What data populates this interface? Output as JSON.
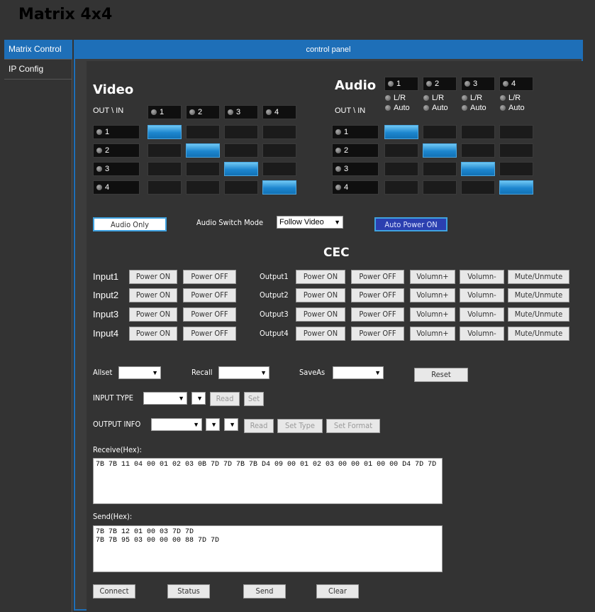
{
  "app": {
    "title": "Matrix 4x4"
  },
  "sidebar": {
    "items": [
      {
        "label": "Matrix Control"
      },
      {
        "label": "IP Config"
      }
    ]
  },
  "main": {
    "header": "control panel"
  },
  "video": {
    "title": "Video",
    "corner_label": "OUT \\ IN",
    "inputs": [
      "1",
      "2",
      "3",
      "4"
    ],
    "outputs": [
      "1",
      "2",
      "3",
      "4"
    ],
    "routing": [
      1,
      2,
      3,
      4
    ]
  },
  "audio": {
    "title": "Audio",
    "corner_label": "OUT \\ IN",
    "inputs": [
      "1",
      "2",
      "3",
      "4"
    ],
    "outputs": [
      "1",
      "2",
      "3",
      "4"
    ],
    "lr_label": "L/R",
    "auto_label": "Auto",
    "routing": [
      1,
      2,
      3,
      4
    ]
  },
  "controls": {
    "audio_only": "Audio Only",
    "audio_switch_mode_label": "Audio Switch Mode",
    "audio_switch_mode_value": "Follow Video",
    "auto_power_on": "Auto Power ON"
  },
  "cec": {
    "title": "CEC",
    "inputs": [
      {
        "label": "Input1",
        "power_on": "Power ON",
        "power_off": "Power OFF"
      },
      {
        "label": "Input2",
        "power_on": "Power ON",
        "power_off": "Power OFF"
      },
      {
        "label": "Input3",
        "power_on": "Power ON",
        "power_off": "Power OFF"
      },
      {
        "label": "Input4",
        "power_on": "Power ON",
        "power_off": "Power OFF"
      }
    ],
    "outputs": [
      {
        "label": "Output1",
        "power_on": "Power ON",
        "power_off": "Power OFF",
        "vol_up": "Volumn+",
        "vol_down": "Volumn-",
        "mute": "Mute/Unmute"
      },
      {
        "label": "Output2",
        "power_on": "Power ON",
        "power_off": "Power OFF",
        "vol_up": "Volumn+",
        "vol_down": "Volumn-",
        "mute": "Mute/Unmute"
      },
      {
        "label": "Output3",
        "power_on": "Power ON",
        "power_off": "Power OFF",
        "vol_up": "Volumn+",
        "vol_down": "Volumn-",
        "mute": "Mute/Unmute"
      },
      {
        "label": "Output4",
        "power_on": "Power ON",
        "power_off": "Power OFF",
        "vol_up": "Volumn+",
        "vol_down": "Volumn-",
        "mute": "Mute/Unmute"
      }
    ]
  },
  "presets": {
    "allset": "Allset",
    "recall": "Recall",
    "saveas": "SaveAs",
    "reset": "Reset"
  },
  "input_type": {
    "label": "INPUT TYPE",
    "read": "Read",
    "set": "Set"
  },
  "output_info": {
    "label": "OUTPUT INFO",
    "read": "Read",
    "set_type": "Set Type",
    "set_format": "Set Format"
  },
  "receive": {
    "label": "Receive(Hex):",
    "value": "7B 7B 11 04 00 01 02 03 0B 7D 7D 7B 7B D4 09 00 01 02 03 00 00 01 00 00 D4 7D 7D"
  },
  "send": {
    "label": "Send(Hex):",
    "value": "7B 7B 12 01 00 03 7D 7D\n7B 7B 95 03 00 00 00 88 7D 7D"
  },
  "bottom": {
    "connect": "Connect",
    "status": "Status",
    "send": "Send",
    "clear": "Clear"
  },
  "colors": {
    "accent": "#1e6fb8",
    "active_cell": "#1d86cf"
  }
}
